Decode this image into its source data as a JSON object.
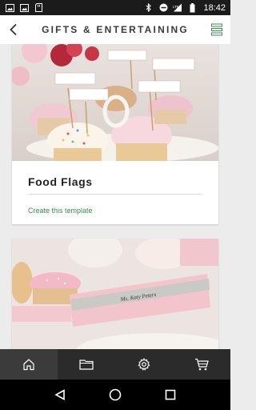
{
  "status_bar": {
    "time": "18:42",
    "left_icons": [
      "image-icon",
      "image-icon",
      "sd-card-icon"
    ],
    "right_icons": [
      "bluetooth-icon",
      "do-not-disturb-icon",
      "lte-signal-icon",
      "battery-icon"
    ]
  },
  "header": {
    "title": "GIFTS & ENTERTAINING",
    "accent_color": "#3a8a52"
  },
  "cards": [
    {
      "title": "Food Flags",
      "link": "Create this template",
      "image": "cupcakes-with-flags"
    },
    {
      "title": "",
      "link": "",
      "image": "place-card-ms-katy-peters"
    }
  ],
  "bottom_nav": {
    "items": [
      "home-icon",
      "folder-icon",
      "gear-icon",
      "cart-icon"
    ],
    "active": "home-icon"
  },
  "system_nav": [
    "back-triangle-icon",
    "home-circle-icon",
    "recents-square-icon"
  ]
}
